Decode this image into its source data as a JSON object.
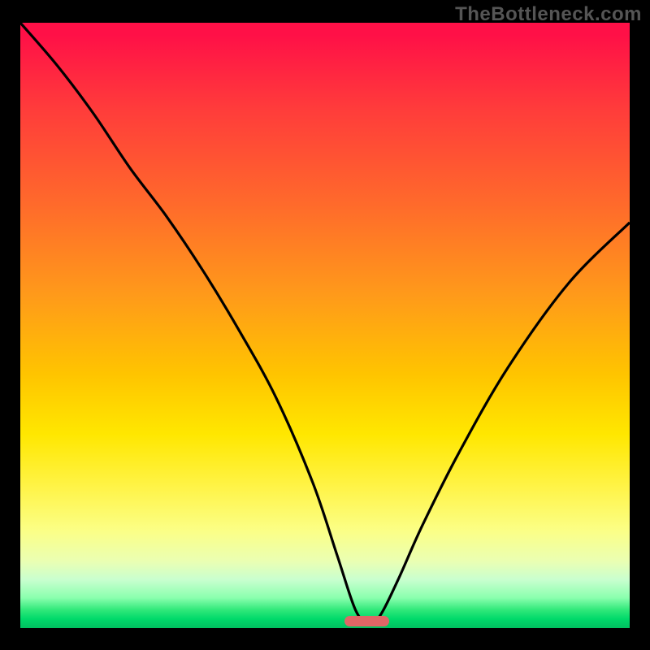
{
  "watermark": {
    "text": "TheBottleneck.com"
  },
  "colors": {
    "curve": "#000000",
    "bar": "#e06666",
    "frame": "#000000"
  },
  "chart_data": {
    "type": "line",
    "title": "",
    "xlabel": "",
    "ylabel": "",
    "xlim": [
      0,
      100
    ],
    "ylim": [
      0,
      100
    ],
    "grid": false,
    "notes": "Bottleneck-style V-curve. y is bottleneck % (0 = green/ideal, 100 = red/severe). Minimum at x≈57. Curve descends from top-left, dips to near zero around x=54–60, then rises toward upper-right.",
    "x": [
      0,
      6,
      12,
      18,
      24,
      30,
      36,
      42,
      48,
      52,
      55,
      57,
      59,
      62,
      66,
      72,
      80,
      90,
      100
    ],
    "values": [
      100,
      93,
      85,
      76,
      68,
      59,
      49,
      38,
      24,
      12,
      3,
      1,
      2,
      8,
      17,
      29,
      43,
      57,
      67
    ],
    "optimal_band": {
      "x_start": 53.2,
      "x_end": 60.5,
      "y": 1.2
    }
  }
}
